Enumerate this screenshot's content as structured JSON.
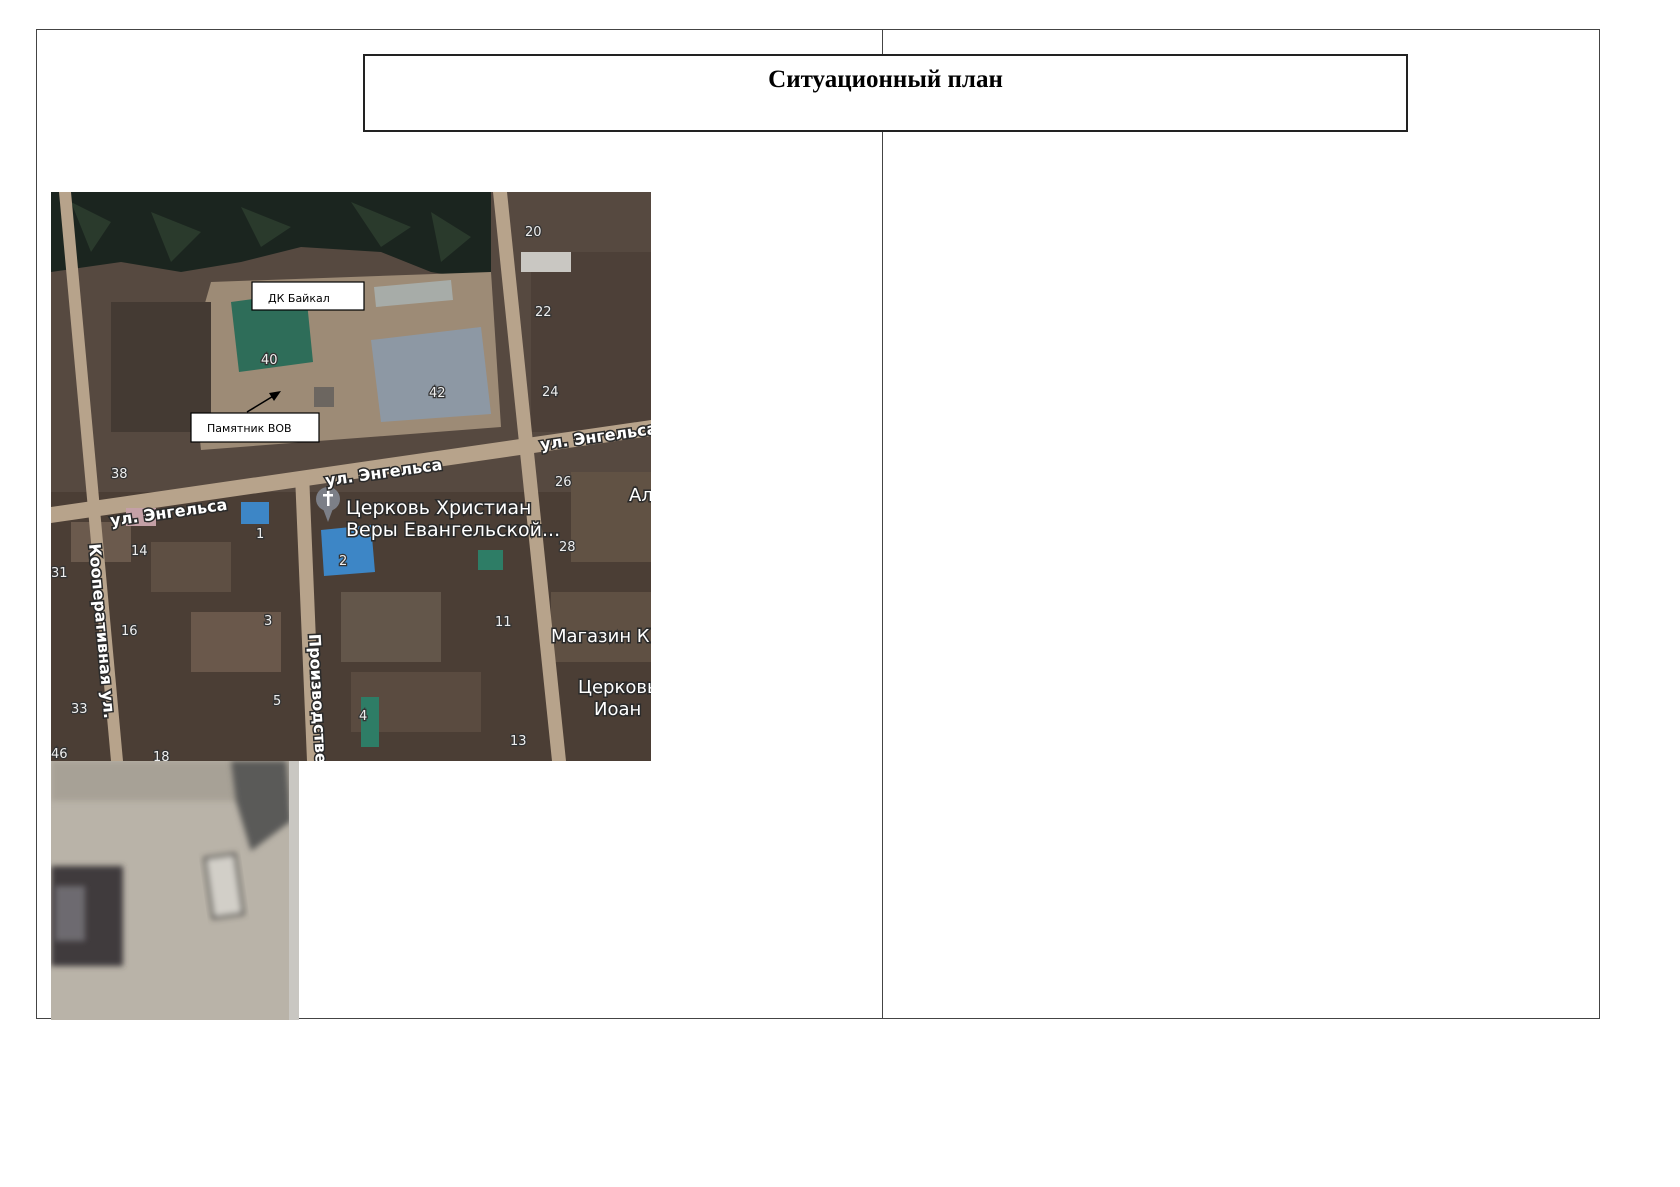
{
  "title": "Ситуационный план",
  "map": {
    "callouts": {
      "dk": "ДК Байкал",
      "monument": "Памятник ВОВ"
    },
    "streets": {
      "engelsa_right": "ул. Энгельса",
      "engelsa_mid": "ул. Энгельса",
      "engelsa_left": "ул. Энгельса",
      "kooperativnaya": "Кооперативная ул.",
      "proizvodstvennaya": "Производстве"
    },
    "pois": {
      "church_line1": "Церковь Христиан",
      "church_line2": "Веры Евангельской...",
      "shop": "Магазин К",
      "church2_line1": "Церковь",
      "church2_line2": "Иоан",
      "edge_al": "Ал"
    },
    "house_numbers": {
      "n40": "40",
      "n42": "42",
      "n20": "20",
      "n22": "22",
      "n24": "24",
      "n26": "26",
      "n28": "28",
      "n38": "38",
      "n14": "14",
      "n16": "16",
      "n31": "31",
      "n33": "33",
      "n46": "46",
      "n18": "18",
      "n3": "3",
      "n5": "5",
      "n2": "2",
      "n4": "4",
      "n11": "11",
      "n13": "13",
      "n1": "1"
    },
    "colors": {
      "road": "#b7a38b",
      "forest": "#1b251f",
      "ground": "#5a4c42",
      "roof_green": "#2e6d59",
      "roof_blue": "#3d86c6"
    }
  }
}
